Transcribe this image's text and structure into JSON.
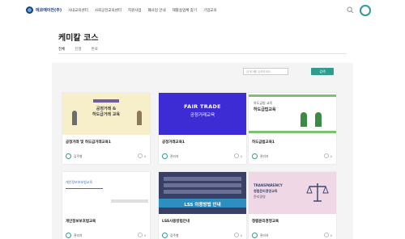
{
  "header": {
    "logo_text": "에코에이전(주)",
    "nav": [
      "사내교육센터",
      "사회공헌교육센터",
      "지원사업",
      "폐사업 안내",
      "재활용업체 찾기",
      "기업교육"
    ]
  },
  "page": {
    "title": "케미칼 코스",
    "tabs": [
      "전체",
      "진행",
      "완료"
    ]
  },
  "search": {
    "placeholder": "검색어를 입력하세요",
    "button_label": "검색"
  },
  "courses": [
    {
      "title": "공정거래 및 하도급거래교육1",
      "instructor": "김주형",
      "count": "0",
      "thumb_lines": [
        "공정거래 &",
        "하도급거래 교육"
      ]
    },
    {
      "title": "공정거래교육1",
      "instructor": "관리자",
      "count": "0",
      "thumb_lines": [
        "FAIR TRADE",
        "공정거래교육"
      ]
    },
    {
      "title": "하도급법교육1",
      "instructor": "관리자",
      "count": "0",
      "thumb_lines": [
        "하도급법 교육",
        "하도급법교육"
      ]
    },
    {
      "title": "개인정보보호법교육",
      "instructor": "관리자",
      "count": "0",
      "thumb_lines": [
        "개인정보보호법교육"
      ]
    },
    {
      "title": "LSS사용방법안내",
      "instructor": "김주형",
      "count": "0",
      "thumb_lines": [
        "LSS 이용방법 안내"
      ]
    },
    {
      "title": "청렴윤리경영교육",
      "instructor": "관리자",
      "count": "0",
      "thumb_lines": [
        "TRANSPARENCY",
        "청렴윤리경영교육",
        "윤리경영"
      ]
    }
  ],
  "colors": {
    "accent": "#2f9c8f",
    "logo": "#1d3f7a"
  }
}
